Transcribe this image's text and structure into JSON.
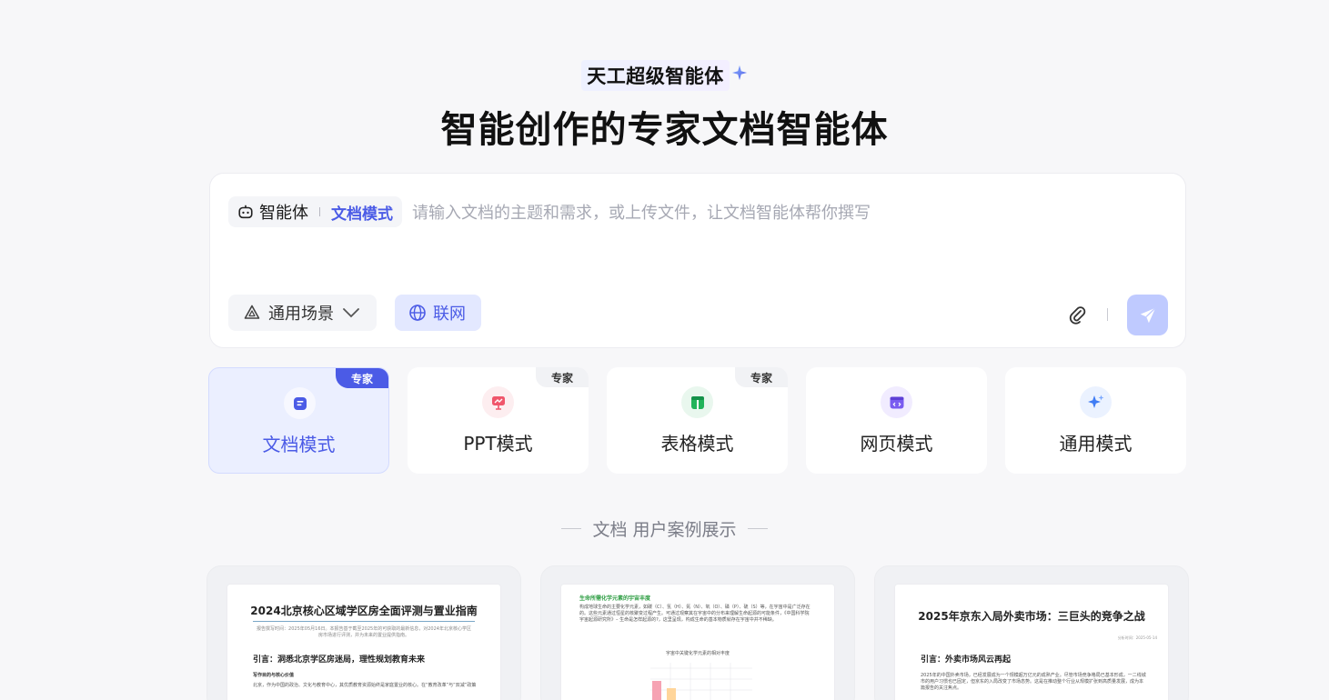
{
  "brand": {
    "name": "天工超级智能体"
  },
  "headline": "智能创作的专家文档智能体",
  "composer": {
    "agent_label": "智能体",
    "agent_mode": "文档模式",
    "placeholder": "请输入文档的主题和需求，或上传文件，让文档智能体帮你撰写",
    "scene_label": "通用场景",
    "web_label": "联网"
  },
  "modes": [
    {
      "label": "文档模式",
      "badge": "专家",
      "active": true,
      "icon": "document-icon",
      "color": "#4b5be6"
    },
    {
      "label": "PPT模式",
      "badge": "专家",
      "active": false,
      "icon": "presentation-icon",
      "color": "#f0566b"
    },
    {
      "label": "表格模式",
      "badge": "专家",
      "active": false,
      "icon": "table-icon",
      "color": "#22b45a"
    },
    {
      "label": "网页模式",
      "badge": "",
      "active": false,
      "icon": "webpage-icon",
      "color": "#7a5cf0"
    },
    {
      "label": "通用模式",
      "badge": "",
      "active": false,
      "icon": "sparkle-icon",
      "color": "#3f7cf4"
    }
  ],
  "cases_title": "文档 用户案例展示",
  "cases": [
    {
      "title": "2024北京核心区域学区房全面评测与置业指南",
      "sub": "报告撰写时间：2025年05月16日。本报告基于截至2025年的可获取的最新信息，对2024年北京核心学区房市场进行评测，并为未来的置业提供指南。",
      "h2": "引言：洞悉北京学区房迷局，理性规划教育未来",
      "h3": "写作目的与核心价值",
      "text": "北京，作为中国的政治、文化与教育中心，其优质教育资源始终是家庭置业的核心。在“教育改革”与“双减”政策"
    },
    {
      "green": "生命所需化学元素的宇宙丰度",
      "text": "构成地球生命的主要化学元素，如碳（C）、氢（H）、氮（N）、氧（O）、磷（P）、硫（S）等，在宇宙中是广泛存在的。这些元素通过恒星的核聚变过程产生。可通过观察其在宇宙中的分布来理解生命起源的可能条件，《中国科学院宇宙起源研究所》– 生命是怎样起源的?，这里呈现，构成生命的基本物质就存在宇宙中并不稀缺。",
      "chart_title": "宇宙中关键化学元素的相对丰度"
    },
    {
      "title": "2025年京东入局外卖市场：三巨头的竞争之战",
      "date": "分析时间：2025-05-14",
      "h2": "引言：外卖市场风云再起",
      "text": "2025年的中国外卖市场，已经发展成为一个规模超万亿元的成熟产业。尽管市场竞争格局已基本形成，一二线城市的用户习惯也已固定，但京东的入局改变了市场态势。这是在推动整个行业从规模扩张到高质量发展，成为本篇报告的关注焦点。"
    }
  ]
}
